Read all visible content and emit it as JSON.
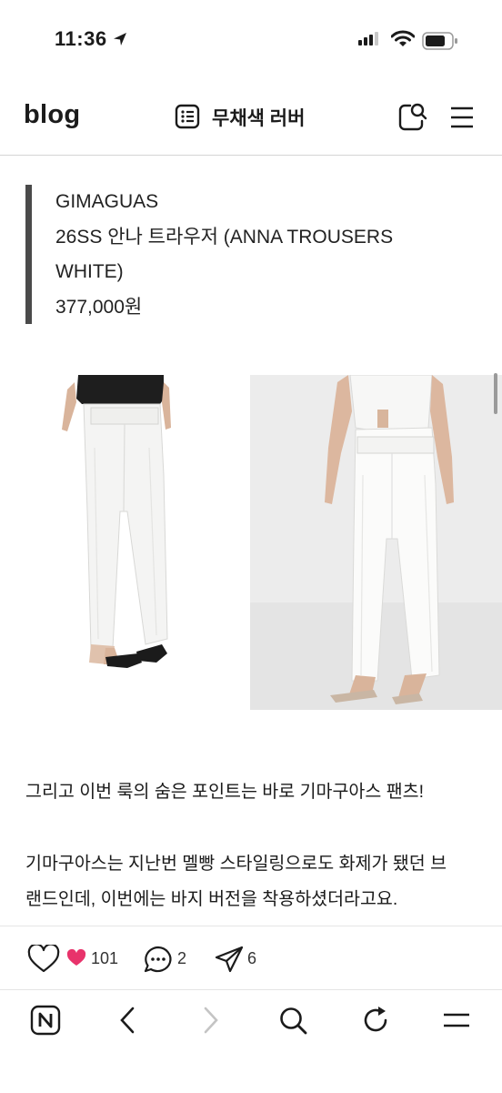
{
  "status_bar": {
    "time": "11:36"
  },
  "header": {
    "logo": "blog",
    "title": "무채색 러버"
  },
  "post": {
    "quote_lines": [
      "GIMAGUAS",
      "26SS 안나 트라우저 (ANNA TROUSERS",
      "WHITE)",
      "377,000원"
    ],
    "paragraphs": [
      "그리고 이번 룩의 숨은 포인트는 바로 기마구아스 팬츠!",
      "기마구아스는 지난번 멜빵 스타일링으로도 화제가 됐던 브",
      "랜드인데, 이번에는 바지 버전을 착용하셨더라고요."
    ]
  },
  "social": {
    "likes": "101",
    "comments": "2",
    "shares": "6"
  },
  "colors": {
    "like_heart": "#e8336b",
    "quote_border": "#4a4a4a"
  }
}
